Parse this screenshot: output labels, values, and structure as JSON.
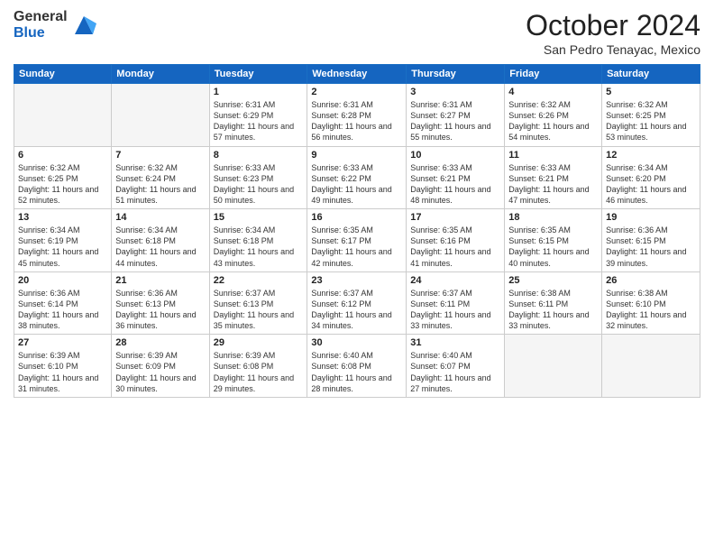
{
  "logo": {
    "general": "General",
    "blue": "Blue"
  },
  "header": {
    "month": "October 2024",
    "location": "San Pedro Tenayac, Mexico"
  },
  "weekdays": [
    "Sunday",
    "Monday",
    "Tuesday",
    "Wednesday",
    "Thursday",
    "Friday",
    "Saturday"
  ],
  "weeks": [
    [
      {
        "day": "",
        "sunrise": "",
        "sunset": "",
        "daylight": ""
      },
      {
        "day": "",
        "sunrise": "",
        "sunset": "",
        "daylight": ""
      },
      {
        "day": "1",
        "sunrise": "Sunrise: 6:31 AM",
        "sunset": "Sunset: 6:29 PM",
        "daylight": "Daylight: 11 hours and 57 minutes."
      },
      {
        "day": "2",
        "sunrise": "Sunrise: 6:31 AM",
        "sunset": "Sunset: 6:28 PM",
        "daylight": "Daylight: 11 hours and 56 minutes."
      },
      {
        "day": "3",
        "sunrise": "Sunrise: 6:31 AM",
        "sunset": "Sunset: 6:27 PM",
        "daylight": "Daylight: 11 hours and 55 minutes."
      },
      {
        "day": "4",
        "sunrise": "Sunrise: 6:32 AM",
        "sunset": "Sunset: 6:26 PM",
        "daylight": "Daylight: 11 hours and 54 minutes."
      },
      {
        "day": "5",
        "sunrise": "Sunrise: 6:32 AM",
        "sunset": "Sunset: 6:25 PM",
        "daylight": "Daylight: 11 hours and 53 minutes."
      }
    ],
    [
      {
        "day": "6",
        "sunrise": "Sunrise: 6:32 AM",
        "sunset": "Sunset: 6:25 PM",
        "daylight": "Daylight: 11 hours and 52 minutes."
      },
      {
        "day": "7",
        "sunrise": "Sunrise: 6:32 AM",
        "sunset": "Sunset: 6:24 PM",
        "daylight": "Daylight: 11 hours and 51 minutes."
      },
      {
        "day": "8",
        "sunrise": "Sunrise: 6:33 AM",
        "sunset": "Sunset: 6:23 PM",
        "daylight": "Daylight: 11 hours and 50 minutes."
      },
      {
        "day": "9",
        "sunrise": "Sunrise: 6:33 AM",
        "sunset": "Sunset: 6:22 PM",
        "daylight": "Daylight: 11 hours and 49 minutes."
      },
      {
        "day": "10",
        "sunrise": "Sunrise: 6:33 AM",
        "sunset": "Sunset: 6:21 PM",
        "daylight": "Daylight: 11 hours and 48 minutes."
      },
      {
        "day": "11",
        "sunrise": "Sunrise: 6:33 AM",
        "sunset": "Sunset: 6:21 PM",
        "daylight": "Daylight: 11 hours and 47 minutes."
      },
      {
        "day": "12",
        "sunrise": "Sunrise: 6:34 AM",
        "sunset": "Sunset: 6:20 PM",
        "daylight": "Daylight: 11 hours and 46 minutes."
      }
    ],
    [
      {
        "day": "13",
        "sunrise": "Sunrise: 6:34 AM",
        "sunset": "Sunset: 6:19 PM",
        "daylight": "Daylight: 11 hours and 45 minutes."
      },
      {
        "day": "14",
        "sunrise": "Sunrise: 6:34 AM",
        "sunset": "Sunset: 6:18 PM",
        "daylight": "Daylight: 11 hours and 44 minutes."
      },
      {
        "day": "15",
        "sunrise": "Sunrise: 6:34 AM",
        "sunset": "Sunset: 6:18 PM",
        "daylight": "Daylight: 11 hours and 43 minutes."
      },
      {
        "day": "16",
        "sunrise": "Sunrise: 6:35 AM",
        "sunset": "Sunset: 6:17 PM",
        "daylight": "Daylight: 11 hours and 42 minutes."
      },
      {
        "day": "17",
        "sunrise": "Sunrise: 6:35 AM",
        "sunset": "Sunset: 6:16 PM",
        "daylight": "Daylight: 11 hours and 41 minutes."
      },
      {
        "day": "18",
        "sunrise": "Sunrise: 6:35 AM",
        "sunset": "Sunset: 6:15 PM",
        "daylight": "Daylight: 11 hours and 40 minutes."
      },
      {
        "day": "19",
        "sunrise": "Sunrise: 6:36 AM",
        "sunset": "Sunset: 6:15 PM",
        "daylight": "Daylight: 11 hours and 39 minutes."
      }
    ],
    [
      {
        "day": "20",
        "sunrise": "Sunrise: 6:36 AM",
        "sunset": "Sunset: 6:14 PM",
        "daylight": "Daylight: 11 hours and 38 minutes."
      },
      {
        "day": "21",
        "sunrise": "Sunrise: 6:36 AM",
        "sunset": "Sunset: 6:13 PM",
        "daylight": "Daylight: 11 hours and 36 minutes."
      },
      {
        "day": "22",
        "sunrise": "Sunrise: 6:37 AM",
        "sunset": "Sunset: 6:13 PM",
        "daylight": "Daylight: 11 hours and 35 minutes."
      },
      {
        "day": "23",
        "sunrise": "Sunrise: 6:37 AM",
        "sunset": "Sunset: 6:12 PM",
        "daylight": "Daylight: 11 hours and 34 minutes."
      },
      {
        "day": "24",
        "sunrise": "Sunrise: 6:37 AM",
        "sunset": "Sunset: 6:11 PM",
        "daylight": "Daylight: 11 hours and 33 minutes."
      },
      {
        "day": "25",
        "sunrise": "Sunrise: 6:38 AM",
        "sunset": "Sunset: 6:11 PM",
        "daylight": "Daylight: 11 hours and 33 minutes."
      },
      {
        "day": "26",
        "sunrise": "Sunrise: 6:38 AM",
        "sunset": "Sunset: 6:10 PM",
        "daylight": "Daylight: 11 hours and 32 minutes."
      }
    ],
    [
      {
        "day": "27",
        "sunrise": "Sunrise: 6:39 AM",
        "sunset": "Sunset: 6:10 PM",
        "daylight": "Daylight: 11 hours and 31 minutes."
      },
      {
        "day": "28",
        "sunrise": "Sunrise: 6:39 AM",
        "sunset": "Sunset: 6:09 PM",
        "daylight": "Daylight: 11 hours and 30 minutes."
      },
      {
        "day": "29",
        "sunrise": "Sunrise: 6:39 AM",
        "sunset": "Sunset: 6:08 PM",
        "daylight": "Daylight: 11 hours and 29 minutes."
      },
      {
        "day": "30",
        "sunrise": "Sunrise: 6:40 AM",
        "sunset": "Sunset: 6:08 PM",
        "daylight": "Daylight: 11 hours and 28 minutes."
      },
      {
        "day": "31",
        "sunrise": "Sunrise: 6:40 AM",
        "sunset": "Sunset: 6:07 PM",
        "daylight": "Daylight: 11 hours and 27 minutes."
      },
      {
        "day": "",
        "sunrise": "",
        "sunset": "",
        "daylight": ""
      },
      {
        "day": "",
        "sunrise": "",
        "sunset": "",
        "daylight": ""
      }
    ]
  ]
}
